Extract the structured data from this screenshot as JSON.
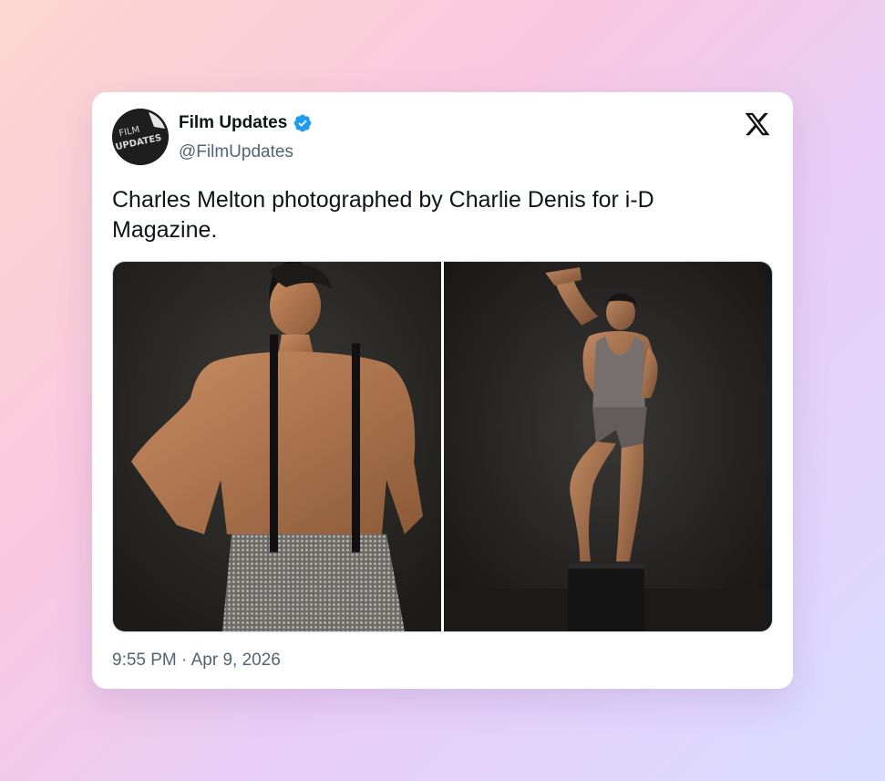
{
  "tweet": {
    "account": {
      "display_name": "Film Updates",
      "handle": "@FilmUpdates",
      "verified": true,
      "avatar_logo_text": [
        "FILM",
        "UPDATES"
      ],
      "verified_color": "#1d9bf0"
    },
    "text": "Charles Melton photographed by Charlie Denis for i-D Magazine.",
    "media": [
      {
        "icon": "photo-1"
      },
      {
        "icon": "photo-2"
      }
    ],
    "timestamp": "9:55 PM · Apr 9, 2026",
    "platform_icon": "x-logo-icon"
  }
}
